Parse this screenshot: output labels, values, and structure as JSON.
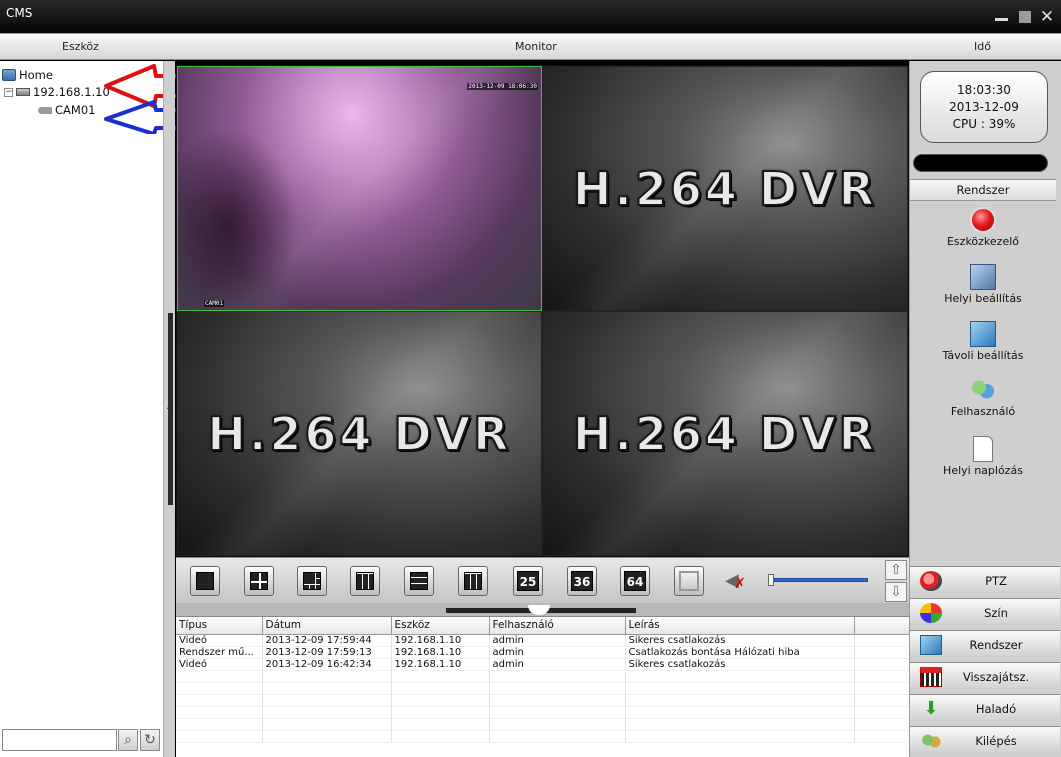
{
  "window": {
    "title": "CMS"
  },
  "header": {
    "left": "Eszköz",
    "center": "Monitor",
    "right": "Idő"
  },
  "tree": {
    "root": "Home",
    "device": "192.168.1.10",
    "camera": "CAM01"
  },
  "video": {
    "live_osd_time": "2013-12-09 18:06:30",
    "live_osd_name": "CAM01",
    "placeholder_logo": "H.264 DVR"
  },
  "status": {
    "time": "18:03:30",
    "date": "2013-12-09",
    "cpu": "CPU : 39%"
  },
  "system_panel": {
    "header": "Rendszer",
    "items": [
      {
        "label": "Eszközkezelő",
        "icon": "device-manager-icon"
      },
      {
        "label": "Helyi beállítás",
        "icon": "local-settings-icon"
      },
      {
        "label": "Távoli beállítás",
        "icon": "remote-settings-icon"
      },
      {
        "label": "Felhasználó",
        "icon": "user-icon"
      },
      {
        "label": "Helyi naplózás",
        "icon": "local-log-icon"
      }
    ]
  },
  "menu": [
    {
      "label": "PTZ",
      "icon": "ptz-icon"
    },
    {
      "label": "Szín",
      "icon": "color-icon"
    },
    {
      "label": "Rendszer",
      "icon": "system-icon"
    },
    {
      "label": "Visszajátsz.",
      "icon": "playback-icon"
    },
    {
      "label": "Haladó",
      "icon": "advanced-icon"
    },
    {
      "label": "Kilépés",
      "icon": "exit-icon"
    }
  ],
  "toolbar": {
    "num_25": "25",
    "num_36": "36",
    "num_64": "64",
    "volume_level": 0.0
  },
  "log": {
    "columns": [
      "Típus",
      "Dátum",
      "Eszköz",
      "Felhasználó",
      "Leírás"
    ],
    "rows": [
      [
        "Videó",
        "2013-12-09 17:59:44",
        "192.168.1.10",
        "admin",
        "Sikeres csatlakozás"
      ],
      [
        "Rendszer mű...",
        "2013-12-09 17:59:13",
        "192.168.1.10",
        "admin",
        "Csatlakozás bontása Hálózati hiba"
      ],
      [
        "Videó",
        "2013-12-09 16:42:34",
        "192.168.1.10",
        "admin",
        "Sikeres csatlakozás"
      ]
    ]
  },
  "colors": {
    "annotation_red": "#e01010",
    "annotation_blue": "#1a2fd0",
    "live_border": "#3fbf3f"
  }
}
